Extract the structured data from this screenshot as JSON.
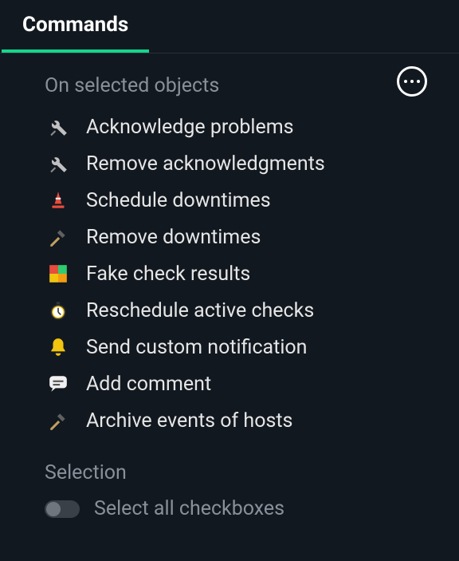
{
  "tabs": {
    "commands_label": "Commands"
  },
  "sections": {
    "on_selected_title": "On selected objects",
    "selection_title": "Selection"
  },
  "commands": {
    "items": [
      {
        "icon": "tools",
        "label": "Acknowledge problems"
      },
      {
        "icon": "tools",
        "label": "Remove acknowledgments"
      },
      {
        "icon": "cone",
        "label": "Schedule downtimes"
      },
      {
        "icon": "hammer",
        "label": "Remove downtimes"
      },
      {
        "icon": "grid",
        "label": "Fake check results"
      },
      {
        "icon": "stopwatch",
        "label": "Reschedule active checks"
      },
      {
        "icon": "bell",
        "label": "Send custom notification"
      },
      {
        "icon": "comment",
        "label": "Add comment"
      },
      {
        "icon": "hammer",
        "label": "Archive events of hosts"
      }
    ]
  },
  "selection": {
    "toggle_label": "Select all checkboxes",
    "toggle_state": false
  }
}
